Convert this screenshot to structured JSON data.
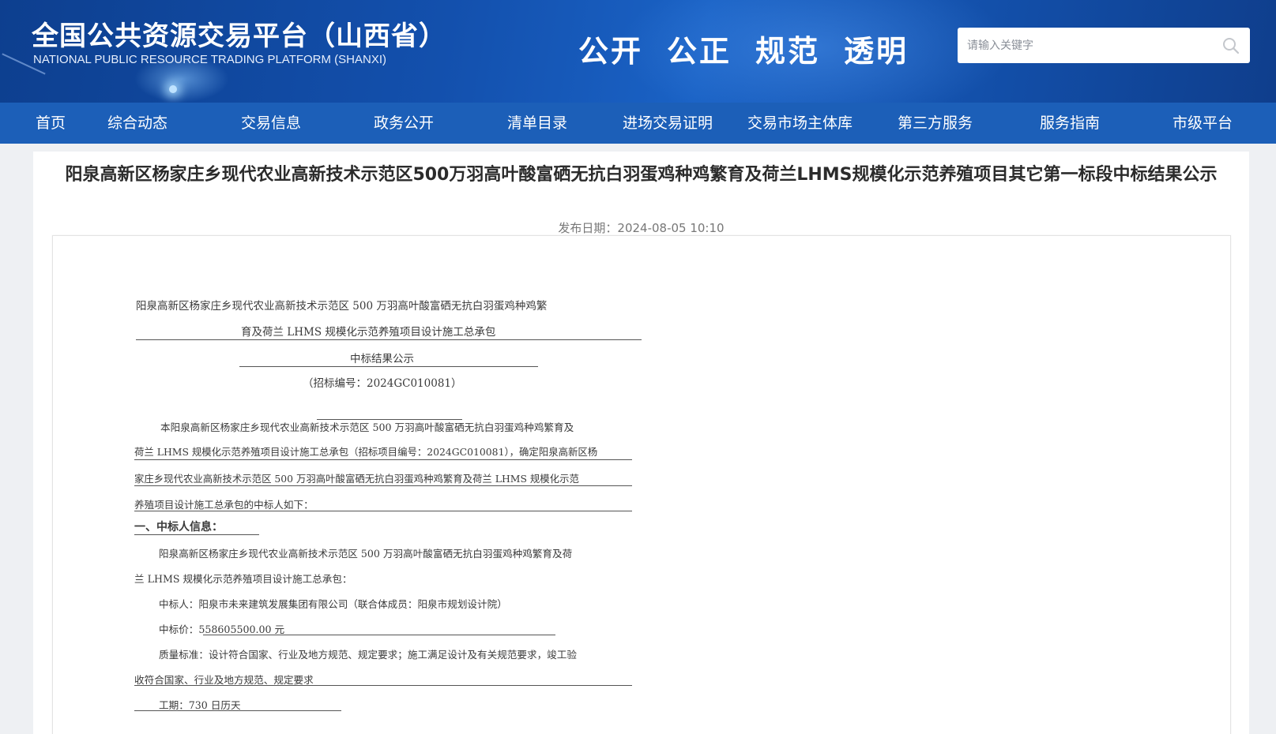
{
  "header": {
    "title": "全国公共资源交易平台（山西省）",
    "subtitle": "NATIONAL PUBLIC RESOURCE TRADING PLATFORM (SHANXI)",
    "slogans": [
      "公开",
      "公正",
      "规范",
      "透明"
    ],
    "search": {
      "placeholder": "请输入关键字",
      "value": "",
      "icon": "search-icon"
    }
  },
  "nav": {
    "items": [
      "首页",
      "综合动态",
      "交易信息",
      "政务公开",
      "清单目录",
      "进场交易证明",
      "交易市场主体库",
      "第三方服务",
      "服务指南",
      "市级平台"
    ]
  },
  "article": {
    "title": "阳泉高新区杨家庄乡现代农业高新技术示范区500万羽高叶酸富硒无抗白羽蛋鸡种鸡繁育及荷兰LHMS规模化示范养殖项目其它第一标段中标结果公示",
    "publish_date": "发布日期：2024-08-05 10:10"
  },
  "document": {
    "heading_line1": "阳泉高新区杨家庄乡现代农业高新技术示范区 500 万羽高叶酸富硒无抗白羽蛋鸡种鸡繁",
    "heading_line2": "育及荷兰 LHMS 规模化示范养殖项目设计施工总承包",
    "heading_line3": "中标结果公示",
    "tender_no": "（招标编号：2024GC010081）",
    "intro_1": "本阳泉高新区杨家庄乡现代农业高新技术示范区 500 万羽高叶酸富硒无抗白羽蛋鸡种鸡繁育及",
    "intro_2": "荷兰 LHMS 规模化示范养殖项目设计施工总承包（招标项目编号：2024GC010081），确定阳泉高新区杨",
    "intro_3": "家庄乡现代农业高新技术示范区 500 万羽高叶酸富硒无抗白羽蛋鸡种鸡繁育及荷兰 LHMS 规模化示范",
    "intro_4": "养殖项目设计施工总承包的中标人如下：",
    "section1": "一、中标人信息：",
    "proj_1": "阳泉高新区杨家庄乡现代农业高新技术示范区 500 万羽高叶酸富硒无抗白羽蛋鸡种鸡繁育及荷",
    "proj_2": "兰 LHMS 规模化示范养殖项目设计施工总承包：",
    "winner": "中标人：阳泉市未来建筑发展集团有限公司（联合体成员：阳泉市规划设计院）",
    "price": "中标价：558605500.00 元",
    "quality_1": "质量标准：设计符合国家、行业及地方规范、规定要求；施工满足设计及有关规范要求，竣工验",
    "quality_2": "收符合国家、行业及地方规范、规定要求",
    "duration": "工期：730 日历天"
  },
  "colors": {
    "header_bg": "#1350ad",
    "nav_bg": "#1c5fb8",
    "page_bg": "#eef0f3"
  }
}
